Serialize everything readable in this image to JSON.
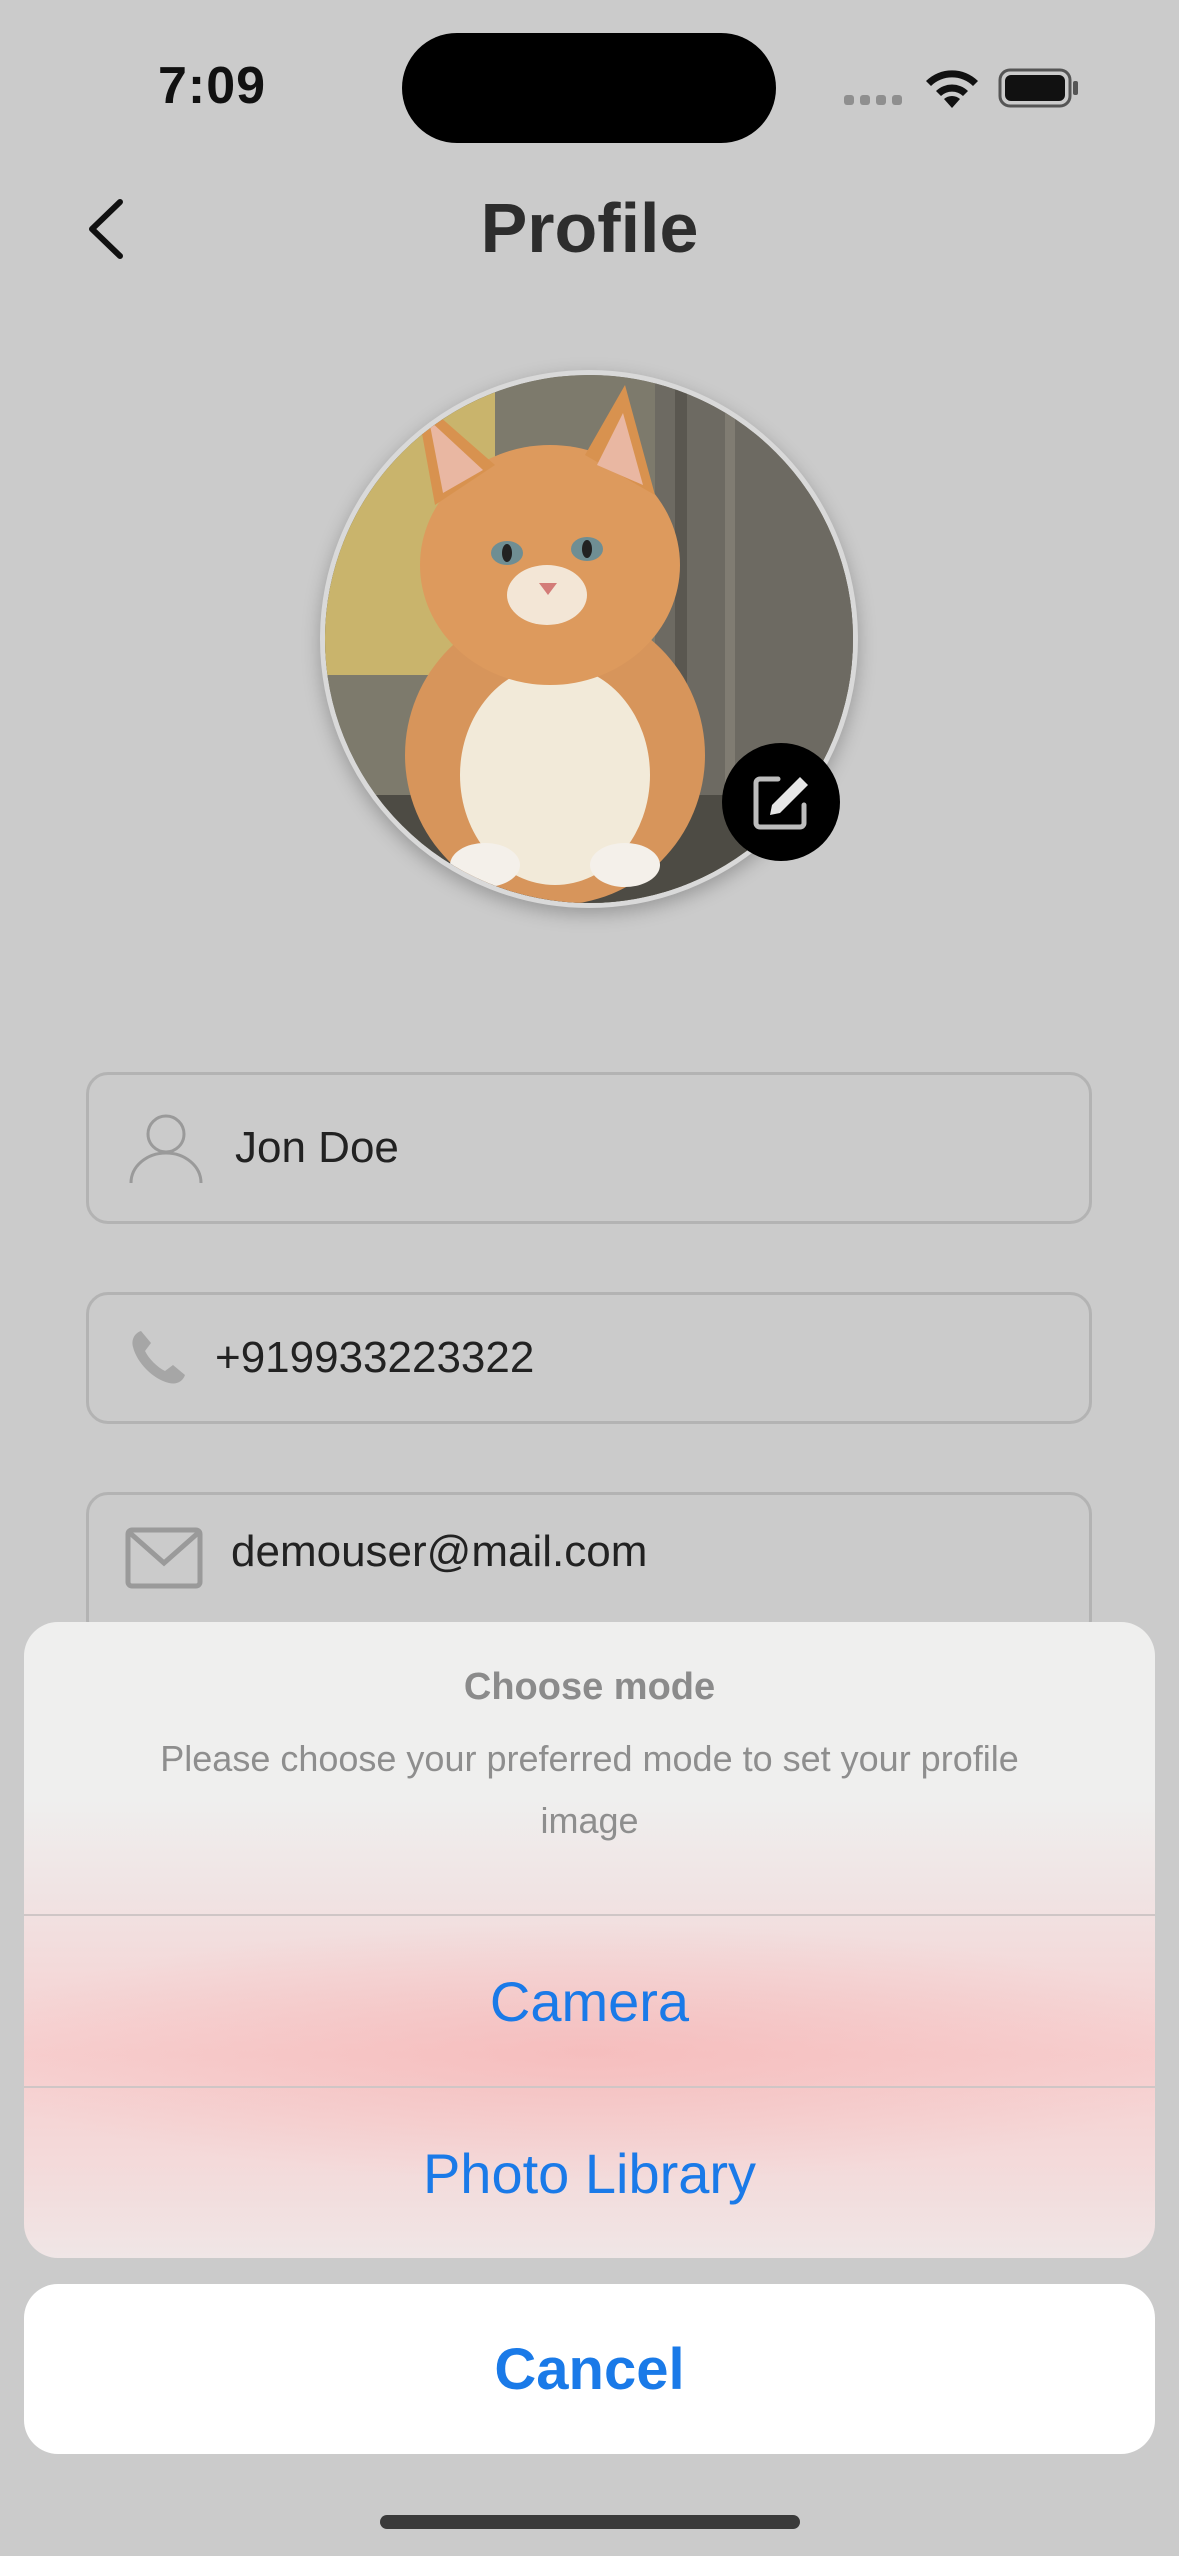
{
  "status_bar": {
    "time": "7:09"
  },
  "header": {
    "title": "Profile",
    "back_icon": "chevron-left-icon"
  },
  "profile": {
    "avatar_description": "kitten-photo",
    "edit_icon": "edit-square-icon",
    "name": "Jon Doe",
    "phone": "+919933223322",
    "email": "demouser@mail.com"
  },
  "action_sheet": {
    "title": "Choose mode",
    "message": "Please choose your preferred mode to set your profile image",
    "actions": [
      {
        "label": "Camera"
      },
      {
        "label": "Photo Library"
      }
    ],
    "cancel_label": "Cancel"
  },
  "colors": {
    "background": "#cbcbcb",
    "accent": "#1a7ae8",
    "title_text": "#2d2d2d"
  }
}
